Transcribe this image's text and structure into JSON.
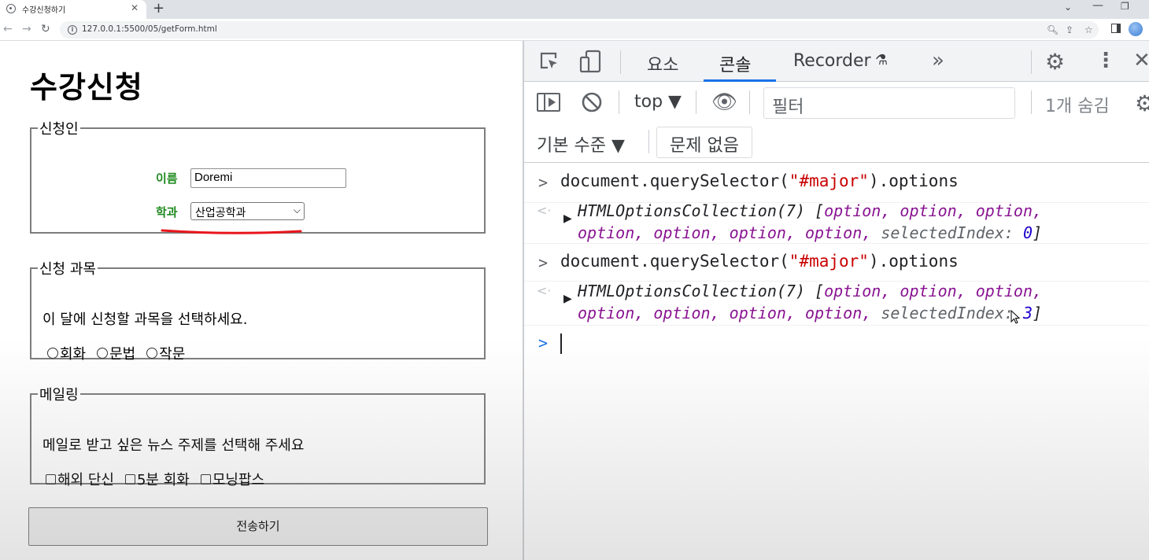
{
  "browser": {
    "tab_title": "수강신청하기",
    "new_tab_label": "+",
    "url": "127.0.0.1:5500/05/getForm.html",
    "info_glyph": "i"
  },
  "page": {
    "title": "수강신청",
    "applicant": {
      "legend": "신청인",
      "name_label": "이름",
      "name_value": "Doremi",
      "dept_label": "학과",
      "dept_value": "산업공학과"
    },
    "courses": {
      "legend": "신청 과목",
      "instruction": "이 달에 신청할 과목을 선택하세요.",
      "options": [
        "회화",
        "문법",
        "작문"
      ]
    },
    "mailing": {
      "legend": "메일링",
      "instruction": "메일로 받고 싶은 뉴스 주제를 선택해 주세요",
      "options": [
        "해외 단신",
        "5분 회화",
        "모닝팝스"
      ]
    },
    "submit_label": "전송하기",
    "annotation_color": "#e8161c"
  },
  "devtools": {
    "tabs": {
      "elements": "요소",
      "console": "콘솔",
      "recorder": "Recorder"
    },
    "context": "top ▼",
    "filter_placeholder": "필터",
    "hidden_count": "1개 숨김",
    "level": "기본 수준 ▼",
    "issues": "문제 없음",
    "accent_color": "#1a73e8",
    "entries": [
      {
        "command_prefix": "document.querySelector(",
        "command_arg": "\"#major\"",
        "command_suffix": ").options",
        "result_line1_prefix": "HTMLOptionsCollection(7) [",
        "result_line1_opts": "option, option, option,",
        "result_line2_opts": "option, option, option, option,",
        "selected_key": "selectedIndex:",
        "selected_value": "0"
      },
      {
        "command_prefix": "document.querySelector(",
        "command_arg": "\"#major\"",
        "command_suffix": ").options",
        "result_line1_prefix": "HTMLOptionsCollection(7) [",
        "result_line1_opts": "option, option, option,",
        "result_line2_opts": "option, option, option, option,",
        "selected_key": "selectedIndex:",
        "selected_value": "3"
      }
    ]
  }
}
